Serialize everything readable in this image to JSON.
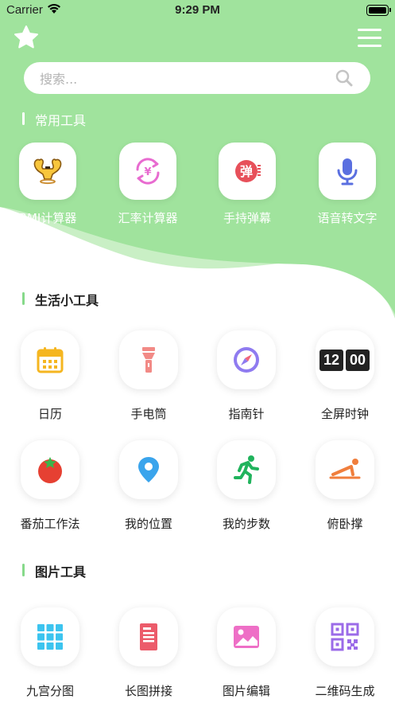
{
  "status_bar": {
    "carrier": "Carrier",
    "time": "9:29 PM"
  },
  "search": {
    "placeholder": "搜索..."
  },
  "sections": {
    "common": "常用工具",
    "life": "生活小工具",
    "image": "图片工具"
  },
  "common_tools": [
    {
      "label": "BMI计算器",
      "icon": "muscle-icon"
    },
    {
      "label": "汇率计算器",
      "icon": "currency-exchange-icon"
    },
    {
      "label": "手持弹幕",
      "icon": "danmaku-icon"
    },
    {
      "label": "语音转文字",
      "icon": "microphone-icon"
    }
  ],
  "life_tools": [
    {
      "label": "日历",
      "icon": "calendar-icon"
    },
    {
      "label": "手电筒",
      "icon": "flashlight-icon"
    },
    {
      "label": "指南针",
      "icon": "compass-icon"
    },
    {
      "label": "全屏时钟",
      "icon": "flip-clock-icon",
      "clock_hours": "12",
      "clock_minutes": "00"
    },
    {
      "label": "番茄工作法",
      "icon": "tomato-icon"
    },
    {
      "label": "我的位置",
      "icon": "location-pin-icon"
    },
    {
      "label": "我的步数",
      "icon": "running-icon"
    },
    {
      "label": "俯卧撑",
      "icon": "pushup-icon"
    }
  ],
  "image_tools": [
    {
      "label": "九宫分图",
      "icon": "grid-icon"
    },
    {
      "label": "长图拼接",
      "icon": "long-image-icon"
    },
    {
      "label": "图片编辑",
      "icon": "image-edit-icon"
    },
    {
      "label": "二维码生成",
      "icon": "qr-code-icon"
    }
  ],
  "colors": {
    "header_green": "#a0e39d",
    "wave_light": "#c9efc5",
    "section_accent": "#86d98a",
    "label_white": "#ffffff"
  }
}
